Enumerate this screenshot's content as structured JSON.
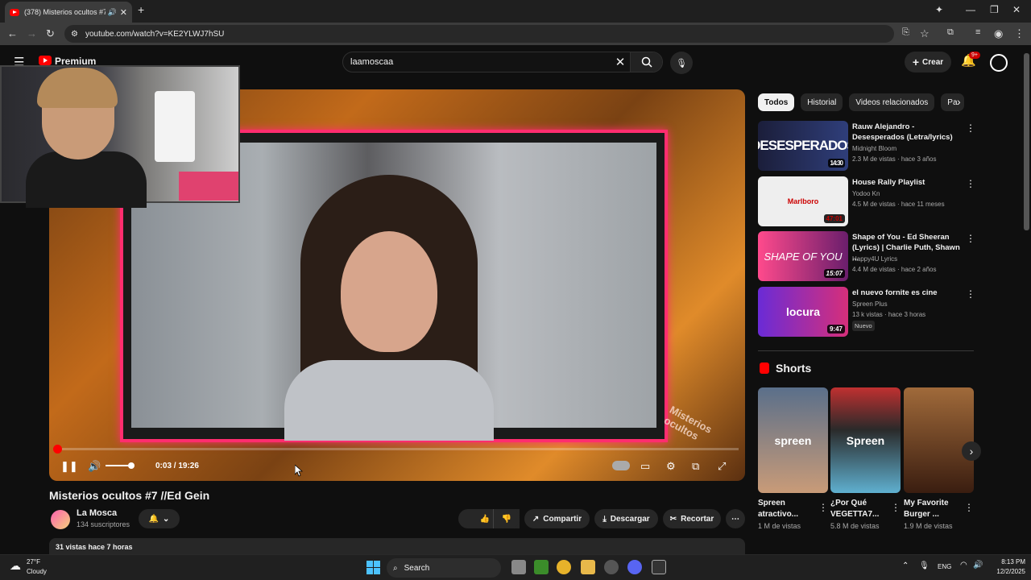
{
  "browser": {
    "tab_title": "(378) Misterios ocultos #7 /",
    "url": "youtube.com/watch?v=KE2YLWJ7hSU"
  },
  "header": {
    "logo_text": "Premium",
    "search_value": "laamoscaa",
    "create_label": "Crear",
    "notif_badge": "9+"
  },
  "player": {
    "time": "0:03 / 19:26",
    "progress_fraction": 0.0026,
    "volume_fraction": 1.0,
    "watermark": "Misterios ocultos"
  },
  "video": {
    "title": "Misterios ocultos #7 //Ed Gein",
    "channel": "La Mosca",
    "subs": "134 suscriptores",
    "likes": "3",
    "share_label": "Compartir",
    "download_label": "Descargar",
    "clip_label": "Recortar",
    "desc_meta": "31 vistas  hace 7 horas"
  },
  "sidebar": {
    "chips": [
      "Todos",
      "Historial",
      "Videos relacionados",
      "Pa"
    ],
    "recs": [
      {
        "title": "Rauw Alejandro - Desesperados (Letra/lyrics)",
        "channel": "Midnight Bloom",
        "meta": "2.3 M de vistas · hace 3 años",
        "duration": "14:30",
        "thumb_text": "DESESPERADOS"
      },
      {
        "title": "House Rally Playlist",
        "channel": "Yodoo Kn",
        "meta": "4.5 M de vistas · hace 11 meses",
        "duration": "47:01",
        "thumb_text": "Marlboro"
      },
      {
        "title": "Shape of You - Ed Sheeran (Lyrics) | Charlie Puth, Shawn ...",
        "channel": "Happy4U Lyrics",
        "meta": "4.4 M de vistas · hace 2 años",
        "duration": "15:07",
        "thumb_text": "SHAPE OF YOU"
      },
      {
        "title": "el nuevo fornite es cine",
        "channel": "Spreen Plus",
        "meta": "13 k vistas · hace 3 horas",
        "duration": "9:47",
        "thumb_text": "locura",
        "badge": "Nuevo"
      }
    ],
    "shorts_title": "Shorts",
    "shorts": [
      {
        "title": "Spreen atractivo...",
        "views": "1 M de vistas",
        "thumb_text": "spreen"
      },
      {
        "title": "¿Por Qué VEGETTA7...",
        "views": "5.8 M de vistas",
        "thumb_text": "Spreen"
      },
      {
        "title": "My Favorite Burger ...",
        "views": "1.9 M de vistas",
        "thumb_text": ""
      }
    ]
  },
  "taskbar": {
    "weather_temp": "27°F",
    "weather_desc": "Cloudy",
    "search": "Search",
    "lang": "ENG",
    "time": "8:13 PM",
    "date": "12/2/2025"
  }
}
